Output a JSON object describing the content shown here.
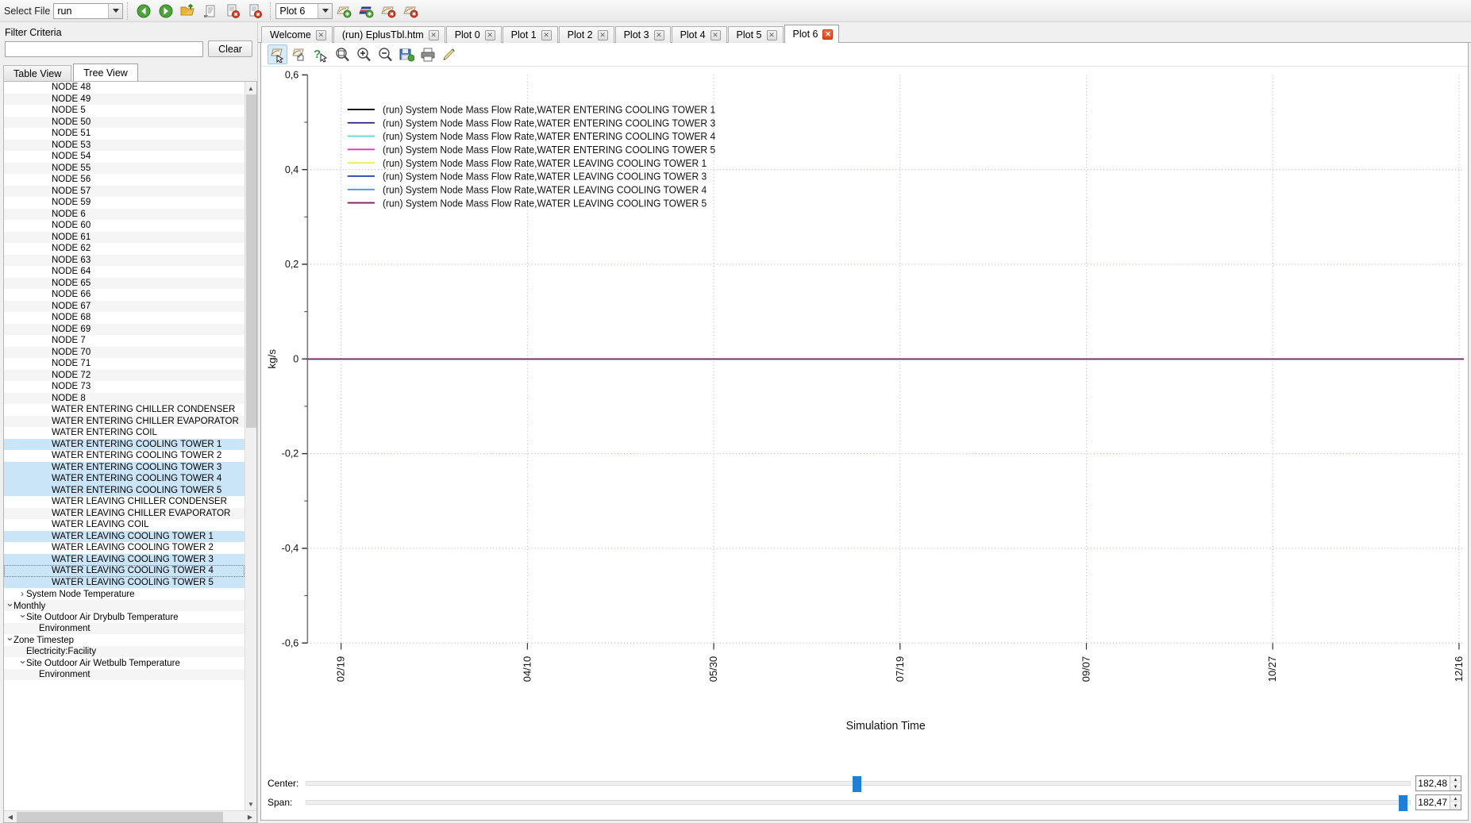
{
  "toolbar": {
    "select_file_label": "Select File",
    "file_value": "run",
    "plot_value": "Plot 6",
    "icons": [
      "back-arrow-icon",
      "forward-arrow-icon",
      "open-folder-icon",
      "report-icon",
      "delete-report-icon",
      "delete-report-all-icon"
    ],
    "plot_icons": [
      "new-plot-icon",
      "new-multi-plot-icon",
      "delete-plot-icon",
      "delete-all-plots-icon"
    ]
  },
  "left_panel": {
    "filter_label": "Filter Criteria",
    "filter_value": "",
    "filter_placeholder": "",
    "clear_label": "Clear",
    "tabs": [
      {
        "label": "Table View",
        "active": false
      },
      {
        "label": "Tree View",
        "active": true
      }
    ],
    "tree_items": [
      {
        "label": "NODE 48",
        "indent": 3,
        "state": "none"
      },
      {
        "label": "NODE 49",
        "indent": 3,
        "state": "none"
      },
      {
        "label": "NODE 5",
        "indent": 3,
        "state": "none"
      },
      {
        "label": "NODE 50",
        "indent": 3,
        "state": "none"
      },
      {
        "label": "NODE 51",
        "indent": 3,
        "state": "none"
      },
      {
        "label": "NODE 53",
        "indent": 3,
        "state": "none"
      },
      {
        "label": "NODE 54",
        "indent": 3,
        "state": "none"
      },
      {
        "label": "NODE 55",
        "indent": 3,
        "state": "none"
      },
      {
        "label": "NODE 56",
        "indent": 3,
        "state": "none"
      },
      {
        "label": "NODE 57",
        "indent": 3,
        "state": "none"
      },
      {
        "label": "NODE 59",
        "indent": 3,
        "state": "none"
      },
      {
        "label": "NODE 6",
        "indent": 3,
        "state": "none"
      },
      {
        "label": "NODE 60",
        "indent": 3,
        "state": "none"
      },
      {
        "label": "NODE 61",
        "indent": 3,
        "state": "none"
      },
      {
        "label": "NODE 62",
        "indent": 3,
        "state": "none"
      },
      {
        "label": "NODE 63",
        "indent": 3,
        "state": "none"
      },
      {
        "label": "NODE 64",
        "indent": 3,
        "state": "none"
      },
      {
        "label": "NODE 65",
        "indent": 3,
        "state": "none"
      },
      {
        "label": "NODE 66",
        "indent": 3,
        "state": "none"
      },
      {
        "label": "NODE 67",
        "indent": 3,
        "state": "none"
      },
      {
        "label": "NODE 68",
        "indent": 3,
        "state": "none"
      },
      {
        "label": "NODE 69",
        "indent": 3,
        "state": "none"
      },
      {
        "label": "NODE 7",
        "indent": 3,
        "state": "none"
      },
      {
        "label": "NODE 70",
        "indent": 3,
        "state": "none"
      },
      {
        "label": "NODE 71",
        "indent": 3,
        "state": "none"
      },
      {
        "label": "NODE 72",
        "indent": 3,
        "state": "none"
      },
      {
        "label": "NODE 73",
        "indent": 3,
        "state": "none"
      },
      {
        "label": "NODE 8",
        "indent": 3,
        "state": "none"
      },
      {
        "label": "WATER ENTERING CHILLER CONDENSER",
        "indent": 3,
        "state": "none"
      },
      {
        "label": "WATER ENTERING CHILLER EVAPORATOR",
        "indent": 3,
        "state": "none"
      },
      {
        "label": "WATER ENTERING COIL",
        "indent": 3,
        "state": "none"
      },
      {
        "label": "WATER ENTERING COOLING TOWER 1",
        "indent": 3,
        "state": "selected"
      },
      {
        "label": "WATER ENTERING COOLING TOWER 2",
        "indent": 3,
        "state": "none"
      },
      {
        "label": "WATER ENTERING COOLING TOWER 3",
        "indent": 3,
        "state": "selected"
      },
      {
        "label": "WATER ENTERING COOLING TOWER 4",
        "indent": 3,
        "state": "selected"
      },
      {
        "label": "WATER ENTERING COOLING TOWER 5",
        "indent": 3,
        "state": "selected"
      },
      {
        "label": "WATER LEAVING CHILLER CONDENSER",
        "indent": 3,
        "state": "none"
      },
      {
        "label": "WATER LEAVING CHILLER EVAPORATOR",
        "indent": 3,
        "state": "none"
      },
      {
        "label": "WATER LEAVING COIL",
        "indent": 3,
        "state": "none"
      },
      {
        "label": "WATER LEAVING COOLING TOWER 1",
        "indent": 3,
        "state": "selected"
      },
      {
        "label": "WATER LEAVING COOLING TOWER 2",
        "indent": 3,
        "state": "none"
      },
      {
        "label": "WATER LEAVING COOLING TOWER 3",
        "indent": 3,
        "state": "selected"
      },
      {
        "label": "WATER LEAVING COOLING TOWER 4",
        "indent": 3,
        "state": "focused"
      },
      {
        "label": "WATER LEAVING COOLING TOWER 5",
        "indent": 3,
        "state": "selected"
      },
      {
        "label": "System Node Temperature",
        "indent": 1,
        "state": "collapsed"
      },
      {
        "label": "Monthly",
        "indent": 0,
        "state": "expanded"
      },
      {
        "label": "Site Outdoor Air Drybulb Temperature",
        "indent": 1,
        "state": "expanded"
      },
      {
        "label": "Environment",
        "indent": 2,
        "state": "none"
      },
      {
        "label": "Zone Timestep",
        "indent": 0,
        "state": "expanded"
      },
      {
        "label": "Electricity:Facility",
        "indent": 1,
        "state": "none"
      },
      {
        "label": "Site Outdoor Air Wetbulb Temperature",
        "indent": 1,
        "state": "expanded"
      },
      {
        "label": "Environment",
        "indent": 2,
        "state": "none"
      }
    ]
  },
  "tabs": [
    {
      "label": "Welcome",
      "active": false,
      "close": "x"
    },
    {
      "label": "(run) EplusTbl.htm",
      "active": false,
      "close": "x"
    },
    {
      "label": "Plot 0",
      "active": false,
      "close": "x"
    },
    {
      "label": "Plot 1",
      "active": false,
      "close": "x"
    },
    {
      "label": "Plot 2",
      "active": false,
      "close": "x"
    },
    {
      "label": "Plot 3",
      "active": false,
      "close": "x"
    },
    {
      "label": "Plot 4",
      "active": false,
      "close": "x"
    },
    {
      "label": "Plot 5",
      "active": false,
      "close": "x"
    },
    {
      "label": "Plot 6",
      "active": true,
      "close": "x"
    }
  ],
  "plot_toolbar": {
    "buttons": [
      {
        "name": "pan-tool-icon",
        "active": true
      },
      {
        "name": "select-tool-icon",
        "active": false
      },
      {
        "name": "query-tool-icon",
        "active": false
      },
      {
        "name": "zoom-fit-icon",
        "active": false
      },
      {
        "name": "zoom-in-icon",
        "active": false
      },
      {
        "name": "zoom-out-icon",
        "active": false
      },
      {
        "name": "save-image-icon",
        "active": false
      },
      {
        "name": "print-icon",
        "active": false
      },
      {
        "name": "properties-icon",
        "active": false
      }
    ]
  },
  "sliders": {
    "center_label": "Center:",
    "center_value": "182,48",
    "span_label": "Span:",
    "span_value": "182,47"
  },
  "chart_data": {
    "type": "line",
    "title": "",
    "xlabel": "Simulation Time",
    "ylabel": "kg/s",
    "ylim": [
      -0.6,
      0.6
    ],
    "yticks": [
      0.6,
      0.4,
      0.2,
      0,
      -0.2,
      -0.4,
      -0.6
    ],
    "ytick_labels": [
      "0,6",
      "0,4",
      "0,2",
      "0",
      "-0,2",
      "-0,4",
      "-0,6"
    ],
    "xtick_labels": [
      "02/19",
      "04/10",
      "05/30",
      "07/19",
      "09/07",
      "10/27",
      "12/16"
    ],
    "grid": true,
    "legend_position": "upper-left-inside",
    "series": [
      {
        "name": "(run) System Node Mass Flow Rate,WATER ENTERING COOLING TOWER  1",
        "color": "#000000",
        "value": 0
      },
      {
        "name": "(run) System Node Mass Flow Rate,WATER ENTERING COOLING TOWER  3",
        "color": "#2e1c80",
        "value": 0
      },
      {
        "name": "(run) System Node Mass Flow Rate,WATER ENTERING COOLING TOWER  4",
        "color": "#5fd8dd",
        "value": 0
      },
      {
        "name": "(run) System Node Mass Flow Rate,WATER ENTERING COOLING TOWER  5",
        "color": "#d43bbf",
        "value": 0
      },
      {
        "name": "(run) System Node Mass Flow Rate,WATER LEAVING COOLING TOWER  1",
        "color": "#f2e85c",
        "value": 0
      },
      {
        "name": "(run) System Node Mass Flow Rate,WATER LEAVING COOLING TOWER  3",
        "color": "#2f4aa8",
        "value": 0
      },
      {
        "name": "(run) System Node Mass Flow Rate,WATER LEAVING COOLING TOWER  4",
        "color": "#3aa0d4",
        "value": 0
      },
      {
        "name": "(run) System Node Mass Flow Rate,WATER LEAVING COOLING TOWER  5",
        "color": "#7a1f5c",
        "value": 0
      }
    ]
  }
}
